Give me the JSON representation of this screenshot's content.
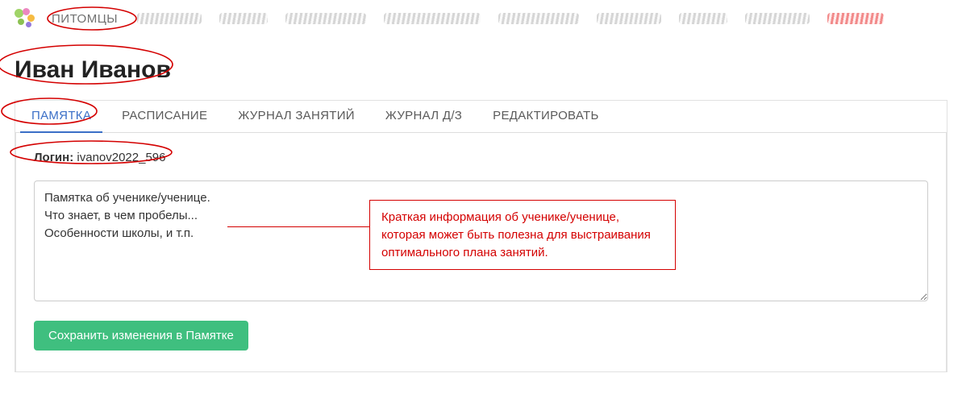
{
  "nav": {
    "main_item": "ПИТОМЦЫ"
  },
  "page": {
    "title": "Иван Иванов"
  },
  "tabs": {
    "memo": "ПАМЯТКА",
    "schedule": "РАСПИСАНИЕ",
    "lessons": "ЖУРНАЛ ЗАНЯТИЙ",
    "homework": "ЖУРНАЛ Д/З",
    "edit": "РЕДАКТИРОВАТЬ"
  },
  "login": {
    "label": "Логин:",
    "value": "ivanov2022_596"
  },
  "memo": {
    "text": "Памятка об ученике/ученице.\nЧто знает, в чем пробелы...\nОсобенности школы, и т.п."
  },
  "buttons": {
    "save": "Сохранить изменения в Памятке"
  },
  "annotation": {
    "text": "Краткая информация об ученике/ученице, которая может быть полезна для выстраивания оптимального плана занятий."
  }
}
